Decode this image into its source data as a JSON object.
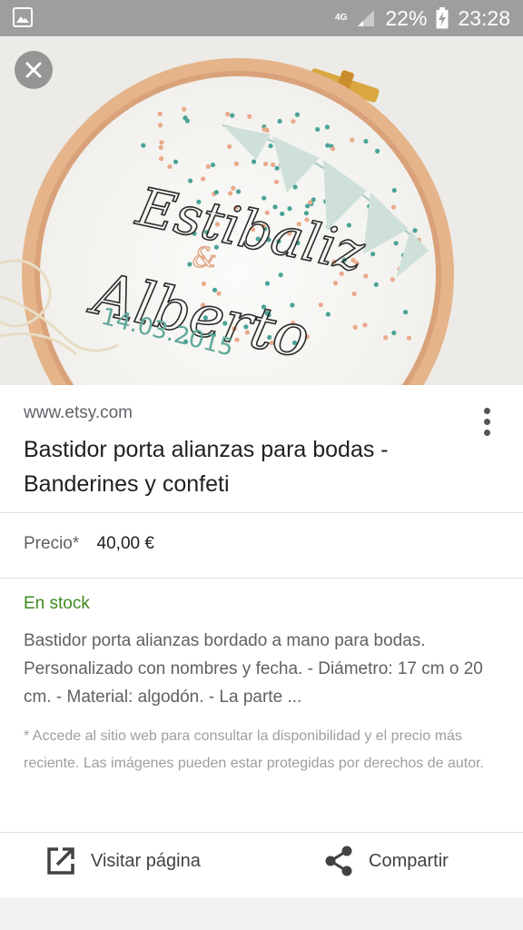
{
  "status_bar": {
    "network_type": "4G",
    "battery": "22%",
    "time": "23:28"
  },
  "image": {
    "text_line_1": "Estibaliz",
    "text_ampersand": "&",
    "text_line_2": "Alberto",
    "text_date": "14.03.2015"
  },
  "result": {
    "source": "www.etsy.com",
    "title": "Bastidor porta alianzas para bodas - Banderines y confeti",
    "price_label": "Precio*",
    "price_value": "40,00 €",
    "stock": "En stock",
    "description": "Bastidor porta alianzas bordado a mano para bodas. Personalizado con nombres y fecha. - Diámetro: 17 cm o 20 cm. - Material: algodón. - La parte ...",
    "disclaimer": "* Accede al sitio web para consultar la disponibilidad y el precio más reciente. Las imágenes pueden estar protegidas por derechos de autor."
  },
  "actions": {
    "visit": "Visitar página",
    "share": "Compartir"
  }
}
